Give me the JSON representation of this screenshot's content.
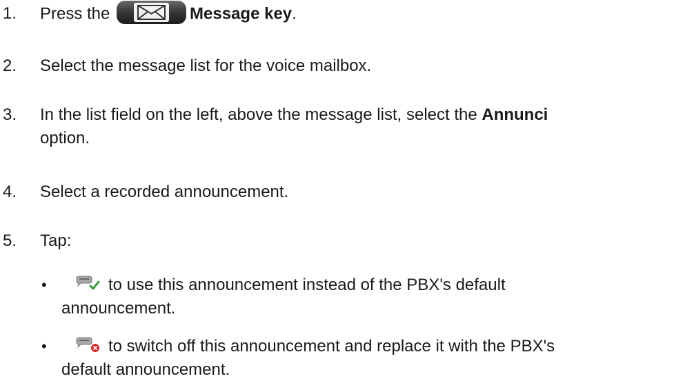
{
  "steps": [
    {
      "number": "1.",
      "before": "Press the ",
      "bold": "Message key",
      "after": ".",
      "icon": "envelope-key-icon"
    },
    {
      "number": "2.",
      "text": "Select the message list for the voice mailbox."
    },
    {
      "number": "3.",
      "line1_before": "In the list field on the left, above the message list, select the ",
      "bold": "Annunci",
      "line2": "option."
    },
    {
      "number": "4.",
      "text": "Select a recorded announcement."
    },
    {
      "number": "5.",
      "text": "Tap:"
    }
  ],
  "bullets": [
    {
      "icon": "announcement-activate-icon",
      "line1": "to use this announcement instead of the PBX's default",
      "line2": "announcement."
    },
    {
      "icon": "announcement-deactivate-icon",
      "line1": "to switch off this announcement and replace it with the PBX's",
      "line2": "default announcement."
    }
  ],
  "colors": {
    "text": "#1a1a1a",
    "key_body": "#3a3a3a",
    "check_green": "#2e9e2e",
    "cross_red": "#d42a2a",
    "bubble_gray": "#8c8c8c"
  }
}
